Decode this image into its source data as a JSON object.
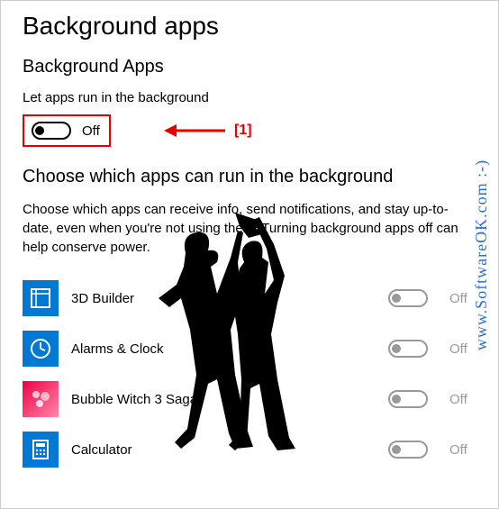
{
  "page_title": "Background apps",
  "section1": {
    "heading": "Background Apps",
    "subtext": "Let apps run in the background",
    "master_toggle": {
      "state": "off",
      "label": "Off"
    }
  },
  "annotation": {
    "marker": "[1]"
  },
  "section2": {
    "heading": "Choose which apps can run in the background",
    "description": "Choose which apps can receive info, send notifications, and stay up-to-date, even when you're not using them. Turning background apps off can help conserve power."
  },
  "apps": [
    {
      "name": "3D Builder",
      "state": "off",
      "label": "Off",
      "icon": "3d-builder-icon"
    },
    {
      "name": "Alarms & Clock",
      "state": "off",
      "label": "Off",
      "icon": "clock-icon"
    },
    {
      "name": "Bubble Witch 3 Saga",
      "state": "off",
      "label": "Off",
      "icon": "bubble-witch-icon"
    },
    {
      "name": "Calculator",
      "state": "off",
      "label": "Off",
      "icon": "calculator-icon"
    }
  ],
  "watermark": "www.SoftwareOK.com  :-)"
}
